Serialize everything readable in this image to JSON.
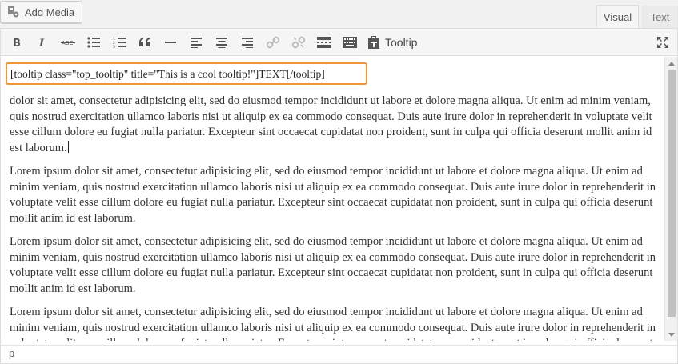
{
  "toolbar_top": {
    "add_media_label": "Add Media"
  },
  "tabs": {
    "visual": "Visual",
    "text": "Text"
  },
  "toolbar": {
    "buttons": [
      "bold",
      "italic",
      "strikethrough",
      "bullet-list",
      "numbered-list",
      "blockquote",
      "horizontal-line",
      "align-left",
      "align-center",
      "align-right",
      "insert-link",
      "remove-link",
      "read-more",
      "toolbar-toggle"
    ],
    "tooltip_label": "Tooltip"
  },
  "content": {
    "shortcode": "[tooltip class=\"top_tooltip\" title=\"This is a cool tooltip!\"]TEXT[/tooltip]",
    "paragraph1": "dolor sit amet, consectetur adipisicing elit, sed do eiusmod tempor incididunt ut labore et dolore magna aliqua. Ut enim ad minim veniam, quis nostrud exercitation ullamco laboris nisi ut aliquip ex ea commodo consequat. Duis aute irure dolor in reprehenderit in voluptate velit esse cillum dolore eu fugiat nulla pariatur. Excepteur sint occaecat cupidatat non proident, sunt in culpa qui officia deserunt mollit anim id est laborum.",
    "paragraph": "Lorem ipsum dolor sit amet, consectetur adipisicing elit, sed do eiusmod tempor incididunt ut labore et dolore magna aliqua. Ut enim ad minim veniam, quis nostrud exercitation ullamco laboris nisi ut aliquip ex ea commodo consequat. Duis aute irure dolor in reprehenderit in voluptate velit esse cillum dolore eu fugiat nulla pariatur. Excepteur sint occaecat cupidatat non proident, sunt in culpa qui officia deserunt mollit anim id est laborum."
  },
  "statusbar": {
    "path": "p"
  },
  "colors": {
    "highlight_border": "#f0953a",
    "spellcheck": "#d54e21"
  }
}
